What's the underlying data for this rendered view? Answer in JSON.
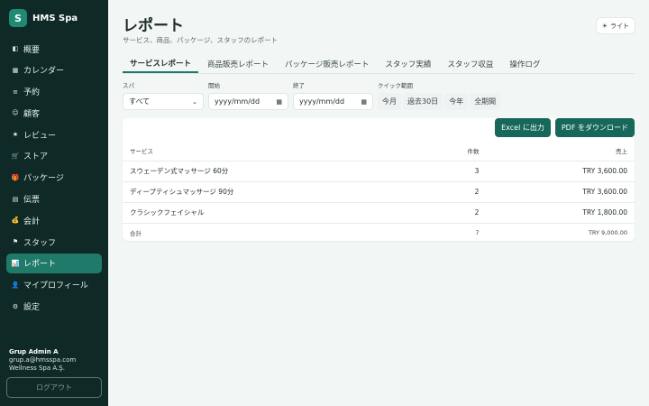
{
  "brand": {
    "logo_letter": "S",
    "name": "HMS Spa"
  },
  "nav": [
    {
      "label": "概要",
      "icon": "chart-icon",
      "glyph": "◧",
      "name": "sidebar-item-overview"
    },
    {
      "label": "カレンダー",
      "icon": "calendar-icon",
      "glyph": "▦",
      "name": "sidebar-item-calendar"
    },
    {
      "label": "予約",
      "icon": "list-icon",
      "glyph": "≡",
      "name": "sidebar-item-reservation"
    },
    {
      "label": "顧客",
      "icon": "user-circle-icon",
      "glyph": "☺",
      "name": "sidebar-item-customers"
    },
    {
      "label": "レビュー",
      "icon": "star-icon",
      "glyph": "★",
      "name": "sidebar-item-reviews"
    },
    {
      "label": "ストア",
      "icon": "cart-icon",
      "glyph": "🛒",
      "name": "sidebar-item-store"
    },
    {
      "label": "パッケージ",
      "icon": "gift-icon",
      "glyph": "🎁",
      "name": "sidebar-item-packages"
    },
    {
      "label": "伝票",
      "icon": "receipt-icon",
      "glyph": "▤",
      "name": "sidebar-item-invoices"
    },
    {
      "label": "会計",
      "icon": "money-bag-icon",
      "glyph": "💰",
      "name": "sidebar-item-accounting"
    },
    {
      "label": "スタッフ",
      "icon": "flag-icon",
      "glyph": "⚑",
      "name": "sidebar-item-staff"
    },
    {
      "label": "レポート",
      "icon": "report-icon",
      "glyph": "📊",
      "name": "sidebar-item-reports",
      "active": true
    },
    {
      "label": "マイプロフィール",
      "icon": "profile-icon",
      "glyph": "👤",
      "name": "sidebar-item-profile"
    },
    {
      "label": "設定",
      "icon": "gear-icon",
      "glyph": "⚙",
      "name": "sidebar-item-settings"
    }
  ],
  "user": {
    "name": "Grup Admin A",
    "email": "grup.a@hmsspa.com",
    "company": "Wellness Spa A.Ş.",
    "logout_label": "ログアウト"
  },
  "header": {
    "title": "レポート",
    "subtitle": "サービス、商品、パッケージ、スタッフのレポート",
    "theme_label": "ライト",
    "theme_icon": "sun-icon"
  },
  "tabs": [
    {
      "label": "サービスレポート",
      "active": true
    },
    {
      "label": "商品販売レポート"
    },
    {
      "label": "パッケージ販売レポート"
    },
    {
      "label": "スタッフ実績"
    },
    {
      "label": "スタッフ収益"
    },
    {
      "label": "操作ログ"
    }
  ],
  "filters": {
    "spa_label": "スパ",
    "spa_value": "すべて",
    "start_label": "開始",
    "start_placeholder": "yyyy/mm/dd",
    "end_label": "終了",
    "end_placeholder": "yyyy/mm/dd",
    "quick_label": "クイック範囲",
    "quick_options": [
      "今月",
      "過去30日",
      "今年",
      "全期間"
    ]
  },
  "actions": {
    "excel_label": "Excel に出力",
    "pdf_label": "PDF をダウンロード"
  },
  "table": {
    "columns": [
      "サービス",
      "件数",
      "売上"
    ],
    "rows": [
      {
        "service": "スウェーデン式マッサージ 60分",
        "count": "3",
        "revenue": "TRY 3,600.00"
      },
      {
        "service": "ディープティシュマッサージ 90分",
        "count": "2",
        "revenue": "TRY 3,600.00"
      },
      {
        "service": "クラシックフェイシャル",
        "count": "2",
        "revenue": "TRY 1,800.00"
      }
    ],
    "total": {
      "label": "合計",
      "count": "7",
      "revenue": "TRY 9,000.00"
    }
  },
  "colors": {
    "sidebar_bg": "#0f2a26",
    "accent": "#1f7a69",
    "button": "#17685a",
    "page_bg": "#f2f7f6"
  }
}
